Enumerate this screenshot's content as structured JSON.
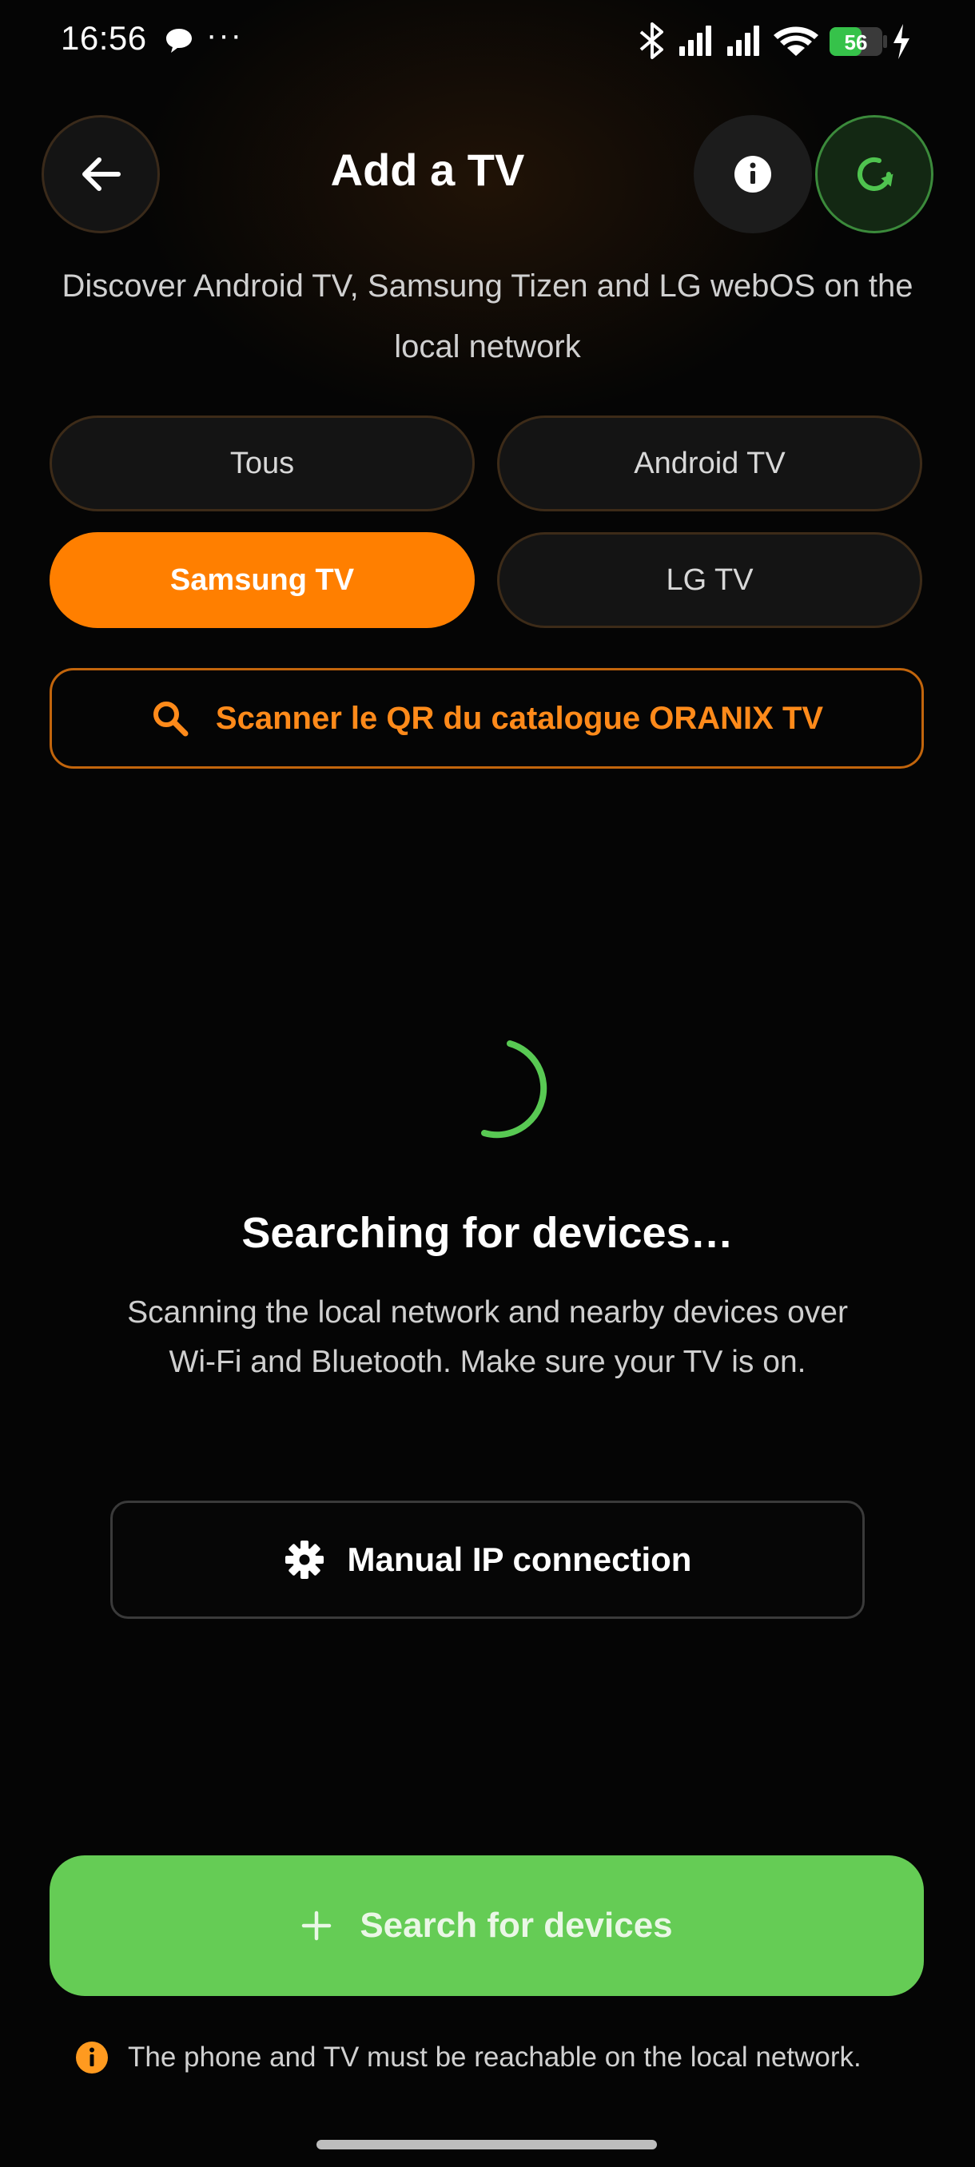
{
  "status_bar": {
    "time": "16:56",
    "dots": "···",
    "battery": "56"
  },
  "header": {
    "title": "Add a TV",
    "subtitle": "Discover Android TV, Samsung Tizen and LG webOS on the local network"
  },
  "filters": [
    {
      "label": "Tous",
      "active": false
    },
    {
      "label": "Android TV",
      "active": false
    },
    {
      "label": "Samsung TV",
      "active": true
    },
    {
      "label": "LG TV",
      "active": false
    }
  ],
  "qr_button": {
    "label": "Scanner le QR du catalogue ORANIX TV",
    "icon": "search-icon"
  },
  "searching": {
    "title": "Searching for devices…",
    "description": "Scanning the local network and nearby devices over Wi-Fi and Bluetooth. Make sure your TV is on."
  },
  "manual_button": {
    "label": "Manual IP connection",
    "icon": "gear-icon"
  },
  "search_button": {
    "label": "Search for devices",
    "icon": "plus-icon"
  },
  "footer": {
    "note": "The phone and TV must be reachable on the local network.",
    "icon": "info-icon"
  },
  "colors": {
    "accent_orange": "#ff7f00",
    "accent_green": "#65cc55",
    "background": "#050505"
  }
}
